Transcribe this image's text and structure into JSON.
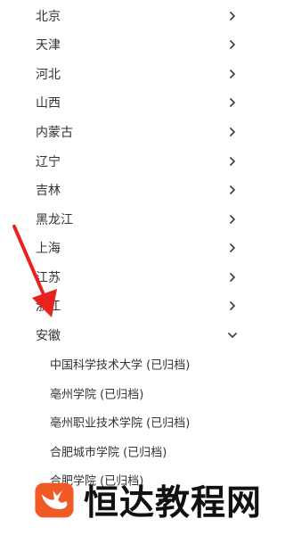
{
  "provinces": [
    {
      "label": "北京",
      "expanded": false
    },
    {
      "label": "天津",
      "expanded": false
    },
    {
      "label": "河北",
      "expanded": false
    },
    {
      "label": "山西",
      "expanded": false
    },
    {
      "label": "内蒙古",
      "expanded": false
    },
    {
      "label": "辽宁",
      "expanded": false
    },
    {
      "label": "吉林",
      "expanded": false
    },
    {
      "label": "黑龙江",
      "expanded": false
    },
    {
      "label": "上海",
      "expanded": false
    },
    {
      "label": "江苏",
      "expanded": false
    },
    {
      "label": "浙江",
      "expanded": false
    },
    {
      "label": "安徽",
      "expanded": true
    }
  ],
  "anhui_schools": [
    {
      "label": "中国科学技术大学 (已归档)"
    },
    {
      "label": "亳州学院 (已归档)"
    },
    {
      "label": "亳州职业技术学院 (已归档)"
    },
    {
      "label": "合肥城市学院 (已归档)"
    },
    {
      "label": "合肥学院 (已归档)"
    }
  ],
  "annotation": {
    "color": "#e8231f"
  },
  "watermark": {
    "text": "恒达教程网",
    "logo_color": "#f05a24"
  },
  "icons": {
    "collapsed": "chevron-right-icon",
    "expanded": "chevron-down-icon"
  }
}
